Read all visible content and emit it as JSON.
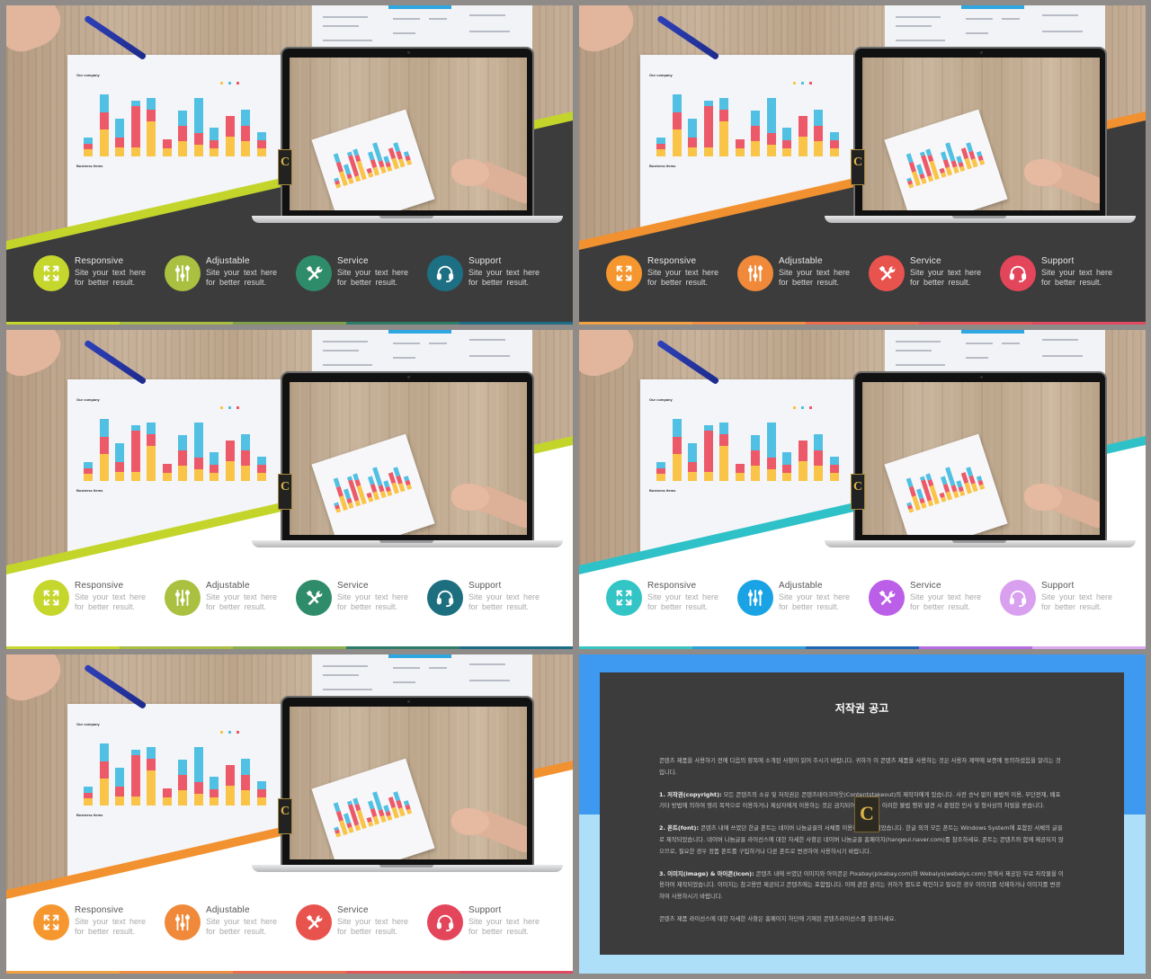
{
  "features": [
    {
      "key": "responsive",
      "title": "Responsive",
      "desc_line1": "Site  your text here",
      "desc_line2": "for  better  result.",
      "icon": "expand-arrows-icon"
    },
    {
      "key": "adjustable",
      "title": "Adjustable",
      "desc_line1": "Site  your text here",
      "desc_line2": "for  better  result.",
      "icon": "sliders-icon"
    },
    {
      "key": "service",
      "title": "Service",
      "desc_line1": "Site  your text here",
      "desc_line2": "for  better  result.",
      "icon": "hammer-wrench-icon"
    },
    {
      "key": "support",
      "title": "Support",
      "desc_line1": "Site  your text here",
      "desc_line2": "for  better  result.",
      "icon": "headset-icon"
    }
  ],
  "slides": [
    {
      "theme": "dark",
      "accent": "#c3d52a",
      "band_color": "#3c3c3c",
      "icon_colors": [
        "#c5d62c",
        "#a9c040",
        "#2f8c6a",
        "#1d7083"
      ],
      "stripe": [
        "#c5d62c",
        "#a8be42",
        "#7f9f4b",
        "#2d7d68",
        "#1d6d86"
      ]
    },
    {
      "theme": "dark",
      "accent": "#f2912f",
      "band_color": "#3c3c3c",
      "icon_colors": [
        "#f5962e",
        "#f08a3a",
        "#e9534d",
        "#e3455b"
      ],
      "stripe": [
        "#f2a143",
        "#ef8e45",
        "#ec6e4d",
        "#e65659",
        "#e04a60"
      ]
    },
    {
      "theme": "light",
      "accent": "#c3d52a",
      "band_color": "#ffffff",
      "icon_colors": [
        "#c5d62c",
        "#a9c040",
        "#2f8c6a",
        "#1d6f80"
      ],
      "stripe": [
        "#c5d62c",
        "#a8be42",
        "#8aae4c",
        "#2d7d68",
        "#1d6d86"
      ]
    },
    {
      "theme": "light",
      "accent": "#2fc1c8",
      "band_color": "#ffffff",
      "icon_colors": [
        "#33c4c6",
        "#1aa3e4",
        "#bb5ee8",
        "#d8a0ee"
      ],
      "stripe": [
        "#39c4c4",
        "#2b9fdc",
        "#1f66b5",
        "#b86ce2",
        "#dba8ef"
      ]
    },
    {
      "theme": "light",
      "accent": "#f2912f",
      "band_color": "#ffffff",
      "icon_colors": [
        "#f5962e",
        "#f08a3a",
        "#e9534d",
        "#e3455b"
      ],
      "stripe": [
        "#f2a143",
        "#ef8e45",
        "#ec6e4d",
        "#e65659",
        "#e04a60"
      ]
    }
  ],
  "photo": {
    "paper_title": "Our company",
    "paper_subtitle": "Business Items",
    "series_colors": [
      "#f9c447",
      "#ec5a6a",
      "#52c0e3"
    ],
    "bars": [
      [
        6,
        5,
        5
      ],
      [
        23,
        15,
        15
      ],
      [
        8,
        8,
        16
      ],
      [
        8,
        35,
        5
      ],
      [
        30,
        10,
        10
      ],
      [
        7,
        8,
        0
      ],
      [
        13,
        13,
        13
      ],
      [
        10,
        10,
        30
      ],
      [
        7,
        7,
        11
      ],
      [
        17,
        18,
        0
      ],
      [
        13,
        13,
        14
      ],
      [
        7,
        7,
        7
      ]
    ]
  },
  "logo_letter": "C",
  "notice": {
    "title": "저작권 공고",
    "intro": "콘텐츠 제품을 사용하기 전에 다음의 항목에 소개된 사항이 읽어 주시기 바랍니다. 귀하가 이 콘텐츠 제품을 사용하는 것은 사용자 계약에 보증에 동의하셨음을 알리는 것입니다.",
    "s1_label": "1. 저작권(copyright):",
    "s1_text": " 모든 콘텐츠의 소유 및 저작권은 콘텐츠테이크아웃(Contentstakeout)의 제작자에게 있습니다. 사전 승낙 없이 불법적 이용, 무단전재, 배포 기타 방법에 의하여 영리 목적으로 이용하거나 제삼자에게 이용하는 것은 금지되어 있습니다. 이러한 불법 행위 발견 시 준엄한 민사 및 형사상의 처벌을 받습니다.",
    "s2_label": "2. 폰트(font):",
    "s2_text": " 콘텐츠 내에 쓰였던 한글 폰트는 네이버 나눔글꼴의 서체를 이용하여 제작되었습니다. 한글 외의 모든 폰트는 Windows System에 포함된 서체의 글꼴로 제작되었습니다. 네이버 나눔글꼴 라이선스에 대한 자세한 사항은 네이버 나눔글꼴 홈페이지(hangeul.naver.com)를 참조하세요. 폰트는 콘텐츠와 함께 제공되지 않으므로, 필요한 경우 정품 폰트를 구입하거나 다른 폰트로 변경하여 사용하시기 바랍니다.",
    "s3_label": "3. 이미지(image) & 아이콘(icon):",
    "s3_text": " 콘텐츠 내에 쓰였던 이미지와 아이콘은 Pixabay(pixabay.com)와 Webalys(webalys.com) 등에서 제공된 무료 저작물을 이용하여 제작되었습니다. 이미지는 참고용만 제공되고 콘텐츠에는 포함됩니다. 이에 관한 권리는 귀하가 별도로 확인하고 필요한 경우 이미지를 삭제하거나 이미지를 변경하여 사용하시기 바랍니다.",
    "outro": "콘텐츠 제품 라이선스에 대한 자세한 사항은 홈페이지 하단에 기재된 콘텐츠라이선스를 참조하세요."
  }
}
